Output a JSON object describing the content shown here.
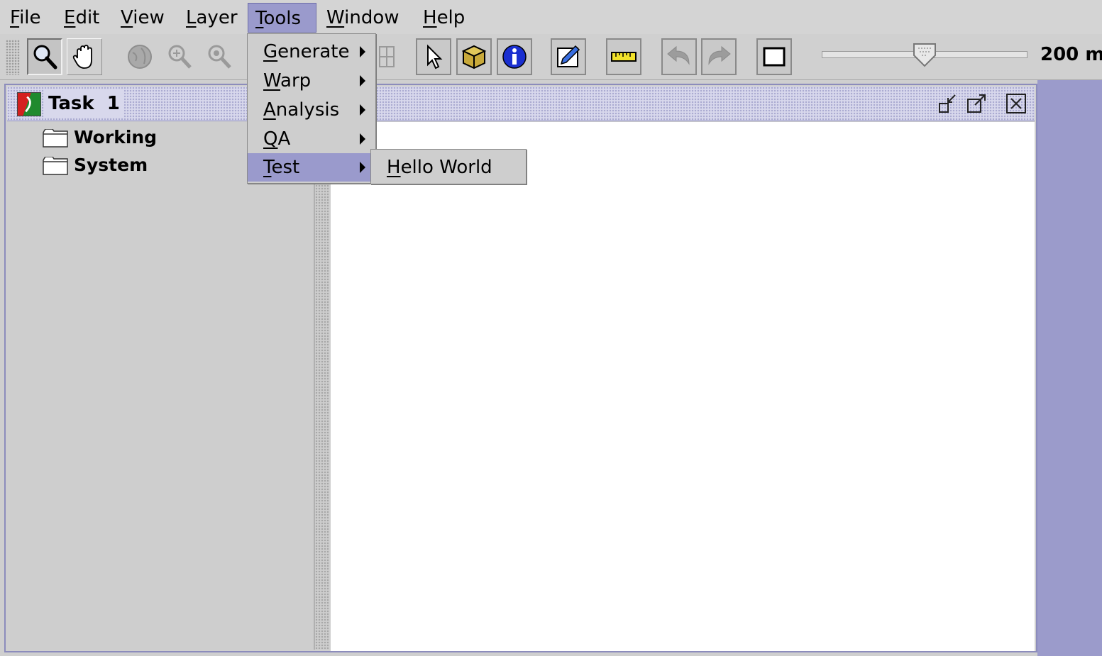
{
  "menubar": {
    "items": [
      {
        "label": "File",
        "mnemonic": "F",
        "rest": "ile"
      },
      {
        "label": "Edit",
        "mnemonic": "E",
        "rest": "dit"
      },
      {
        "label": "View",
        "mnemonic": "V",
        "rest": "iew"
      },
      {
        "label": "Layer",
        "mnemonic": "L",
        "rest": "ayer"
      },
      {
        "label": "Tools",
        "mnemonic": "T",
        "rest": "ools"
      },
      {
        "label": "Window",
        "mnemonic": "W",
        "rest": "indow"
      },
      {
        "label": "Help",
        "mnemonic": "H",
        "rest": "elp"
      }
    ],
    "active": "Tools"
  },
  "tools_menu": {
    "items": [
      {
        "label": "Generate",
        "mnemonic": "G",
        "rest": "enerate",
        "has_submenu": true
      },
      {
        "label": "Warp",
        "mnemonic": "W",
        "rest": "arp",
        "has_submenu": true
      },
      {
        "label": "Analysis",
        "mnemonic": "A",
        "rest": "nalysis",
        "has_submenu": true
      },
      {
        "label": "QA",
        "mnemonic": "Q",
        "rest": "A",
        "has_submenu": true
      },
      {
        "label": "Test",
        "mnemonic": "T",
        "rest": "est",
        "has_submenu": true
      }
    ],
    "selected": "Test"
  },
  "test_submenu": {
    "items": [
      {
        "label": "Hello World",
        "mnemonic": "H",
        "rest": "ello World"
      }
    ]
  },
  "toolbar": {
    "buttons": [
      {
        "icon": "zoom-tool-icon",
        "state": "selected"
      },
      {
        "icon": "pan-hand-icon",
        "state": "enabled"
      },
      {
        "icon": "globe-icon",
        "state": "disabled"
      },
      {
        "icon": "zoom-in-icon",
        "state": "disabled"
      },
      {
        "icon": "zoom-out-icon",
        "state": "disabled"
      },
      {
        "icon": "grid-icon",
        "state": "disabled"
      },
      {
        "icon": "pointer-icon",
        "state": "enabled"
      },
      {
        "icon": "box-icon",
        "state": "enabled"
      },
      {
        "icon": "info-icon",
        "state": "enabled"
      },
      {
        "icon": "edit-icon",
        "state": "enabled"
      },
      {
        "icon": "ruler-icon",
        "state": "enabled"
      },
      {
        "icon": "undo-icon",
        "state": "disabled"
      },
      {
        "icon": "redo-icon",
        "state": "disabled"
      },
      {
        "icon": "frame-icon",
        "state": "enabled"
      }
    ],
    "zoom_slider": {
      "level": 0.5
    },
    "zoom_label": "200 m"
  },
  "frame": {
    "title": "Task  1",
    "tree": {
      "nodes": [
        {
          "label": "Working",
          "icon": "folder-icon"
        },
        {
          "label": "System",
          "icon": "folder-icon"
        }
      ]
    }
  },
  "colors": {
    "selection": "#9a9acc",
    "desktop": "#9b9bcb",
    "chrome": "#cfcfcf",
    "content": "#ffffff"
  }
}
